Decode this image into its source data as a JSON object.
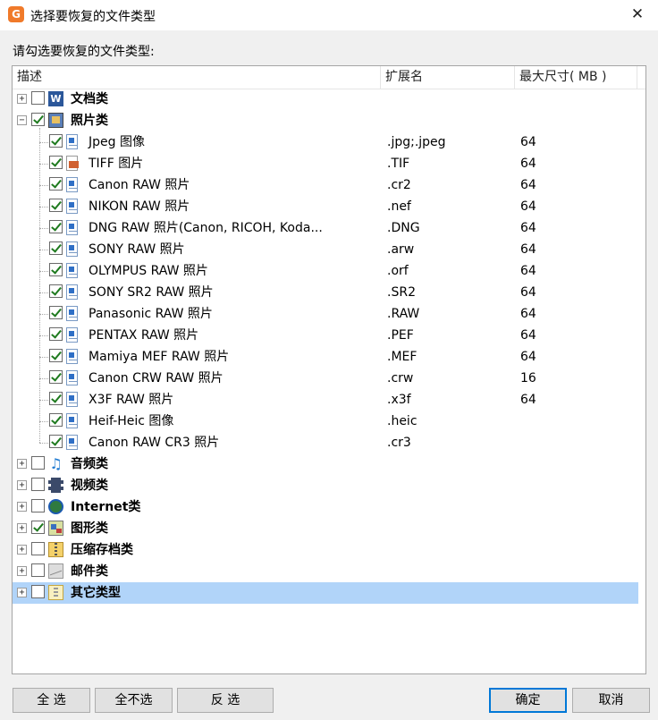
{
  "window": {
    "title": "选择要恢复的文件类型",
    "close_glyph": "✕",
    "logo_letter": "G"
  },
  "prompt": "请勾选要恢复的文件类型:",
  "columns": {
    "desc": "描述",
    "ext": "扩展名",
    "size": "最大尺寸( MB )"
  },
  "categories": [
    {
      "label": "文档类",
      "icon": "word-icon",
      "checked": false,
      "expanded": false
    },
    {
      "label": "照片类",
      "icon": "photo-icon",
      "checked": true,
      "expanded": true,
      "children": [
        {
          "label": "Jpeg 图像",
          "ext": ".jpg;.jpeg",
          "size": "64",
          "icon": "doc-icon"
        },
        {
          "label": "TIFF 图片",
          "ext": ".TIF",
          "size": "64",
          "icon": "image-doc-icon"
        },
        {
          "label": "Canon RAW 照片",
          "ext": ".cr2",
          "size": "64",
          "icon": "doc-icon"
        },
        {
          "label": "NIKON RAW 照片",
          "ext": ".nef",
          "size": "64",
          "icon": "doc-icon"
        },
        {
          "label": "DNG RAW 照片(Canon, RICOH, Koda...",
          "ext": ".DNG",
          "size": "64",
          "icon": "doc-icon"
        },
        {
          "label": "SONY RAW 照片",
          "ext": ".arw",
          "size": "64",
          "icon": "doc-icon"
        },
        {
          "label": "OLYMPUS RAW 照片",
          "ext": ".orf",
          "size": "64",
          "icon": "doc-icon"
        },
        {
          "label": "SONY SR2 RAW 照片",
          "ext": ".SR2",
          "size": "64",
          "icon": "doc-icon"
        },
        {
          "label": "Panasonic RAW 照片",
          "ext": ".RAW",
          "size": "64",
          "icon": "doc-icon"
        },
        {
          "label": "PENTAX RAW 照片",
          "ext": ".PEF",
          "size": "64",
          "icon": "doc-icon"
        },
        {
          "label": "Mamiya MEF RAW 照片",
          "ext": ".MEF",
          "size": "64",
          "icon": "doc-icon"
        },
        {
          "label": "Canon CRW RAW 照片",
          "ext": ".crw",
          "size": "16",
          "icon": "doc-icon"
        },
        {
          "label": "X3F RAW 照片",
          "ext": ".x3f",
          "size": "64",
          "icon": "doc-icon"
        },
        {
          "label": "Heif-Heic 图像",
          "ext": ".heic",
          "size": "",
          "icon": "doc-icon"
        },
        {
          "label": "Canon RAW CR3 照片",
          "ext": ".cr3",
          "size": "",
          "icon": "doc-icon"
        }
      ]
    },
    {
      "label": "音频类",
      "icon": "music-icon",
      "checked": false,
      "expanded": false
    },
    {
      "label": "视频类",
      "icon": "film-icon",
      "checked": false,
      "expanded": false
    },
    {
      "label": "Internet类",
      "icon": "globe-icon",
      "checked": false,
      "expanded": false
    },
    {
      "label": "图形类",
      "icon": "graphic-icon",
      "checked": true,
      "expanded": false
    },
    {
      "label": "压缩存档类",
      "icon": "zip-icon",
      "checked": false,
      "expanded": false
    },
    {
      "label": "邮件类",
      "icon": "mail-icon",
      "checked": false,
      "expanded": false
    },
    {
      "label": "其它类型",
      "icon": "other-icon",
      "checked": false,
      "expanded": false,
      "selected": true
    }
  ],
  "buttons": {
    "select_all": "全 选",
    "select_none": "全不选",
    "invert": "反 选",
    "ok": "确定",
    "cancel": "取消"
  }
}
